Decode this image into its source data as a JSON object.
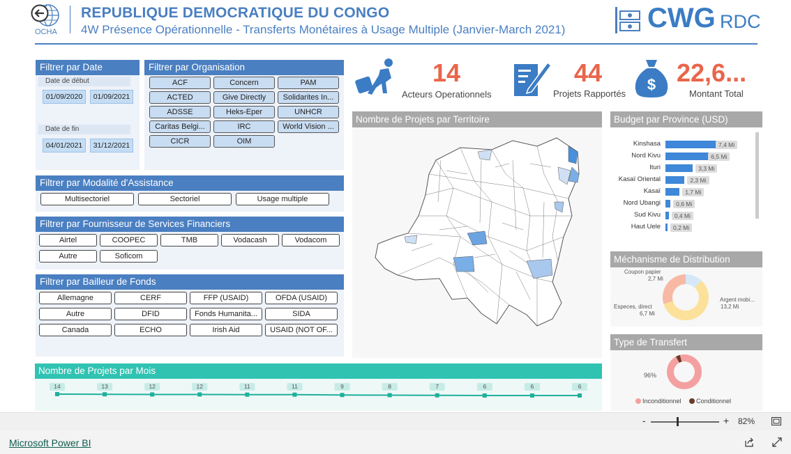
{
  "header": {
    "ocha_label": "OCHA",
    "title": "REPUBLIQUE DEMOCRATIQUE DU CONGO",
    "subtitle": "4W Présence Opérationnelle - Transferts Monétaires à Usage Multiple (Janvier-March 2021)",
    "brand_main": "CWG",
    "brand_sub": "RDC"
  },
  "filters": {
    "date": {
      "title": "Filtrer par Date",
      "start_label": "Date de début",
      "start_from": "01/09/2020",
      "start_to": "01/09/2021",
      "end_label": "Date de fin",
      "end_from": "04/01/2021",
      "end_to": "31/12/2021"
    },
    "organisation": {
      "title": "Filtrer par Organisation",
      "items": [
        "ACF",
        "Concern",
        "PAM",
        "ACTED",
        "Give Directly",
        "Solidarites In...",
        "ADSSE",
        "Heks-Eper",
        "UNHCR",
        "Caritas Belgi...",
        "IRC",
        "World Vision ...",
        "CICR",
        "OIM"
      ]
    },
    "modalite": {
      "title": "Filtrer par Modalité d'Assistance",
      "items": [
        "Multisectoriel",
        "Sectoriel",
        "Usage multiple"
      ]
    },
    "fournisseur": {
      "title": "Filtrer par Fournisseur de Services Financiers",
      "items": [
        "Airtel",
        "COOPEC",
        "TMB",
        "Vodacash",
        "Vodacom",
        "Autre",
        "Soficom"
      ]
    },
    "bailleur": {
      "title": "Filtrer par Bailleur de Fonds",
      "items": [
        "Allemagne",
        "CERF",
        "FFP (USAID)",
        "OFDA (USAID)",
        "Autre",
        "DFID",
        "Fonds Humanita...",
        "SIDA",
        "Canada",
        "ECHO",
        "Irish Aid",
        "USAID (NOT OF..."
      ]
    }
  },
  "kpis": {
    "acteurs": {
      "value": "14",
      "label": "Acteurs Operationnels"
    },
    "projets": {
      "value": "44",
      "label": "Projets Rapportés"
    },
    "montant": {
      "value": "22,6...",
      "label": "Montant Total"
    }
  },
  "map": {
    "title": "Nombre de Projets par Territoire"
  },
  "budget": {
    "title": "Budget par Province (USD)",
    "provinces": [
      {
        "name": "Kinshasa",
        "value": 7.4,
        "label": "7,4 Mi"
      },
      {
        "name": "Nord Kivu",
        "value": 6.5,
        "label": "6,5 Mi"
      },
      {
        "name": "Ituri",
        "value": 3.3,
        "label": "3,3 Mi"
      },
      {
        "name": "Kasaï Oriental",
        "value": 2.3,
        "label": "2,3 Mi"
      },
      {
        "name": "Kasaï",
        "value": 1.7,
        "label": "1,7 Mi"
      },
      {
        "name": "Nord Ubangi",
        "value": 0.6,
        "label": "0,6 Mi"
      },
      {
        "name": "Sud Kivu",
        "value": 0.4,
        "label": "0,4 Mi"
      },
      {
        "name": "Haut Uele",
        "value": 0.2,
        "label": "0,2 Mi"
      }
    ],
    "max": 7.4
  },
  "mechanism": {
    "title": "Méchanisme de Distribution",
    "slices": [
      {
        "name": "Coupon papier",
        "value": 2.7,
        "label": "2,7 Mi",
        "color": "#d4e8f8"
      },
      {
        "name": "Argent mobi...",
        "value": 13.2,
        "label": "13,2 Mi",
        "color": "#fbe19a"
      },
      {
        "name": "Especes, direct",
        "value": 6.7,
        "label": "6,7 Mi",
        "color": "#f7b9a4"
      }
    ]
  },
  "transfer": {
    "title": "Type de Transfert",
    "pct_label": "96%",
    "slices": [
      {
        "name": "Inconditionnel",
        "value": 96,
        "color": "#f4a0a0"
      },
      {
        "name": "Conditionnel",
        "value": 4,
        "color": "#6b3a2a"
      }
    ]
  },
  "monthly": {
    "title": "Nombre de Projets par Mois",
    "values": [
      14,
      13,
      12,
      12,
      11,
      11,
      9,
      8,
      7,
      6,
      6,
      6
    ]
  },
  "zoom": {
    "minus": "-",
    "plus": "+",
    "level": "82%",
    "level_value": 82
  },
  "footer": {
    "link": "Microsoft Power BI"
  },
  "colors": {
    "accent": "#4a7fc1",
    "kpi": "#e9654b",
    "teal": "#30c3b2",
    "bar": "#3f87d8"
  }
}
